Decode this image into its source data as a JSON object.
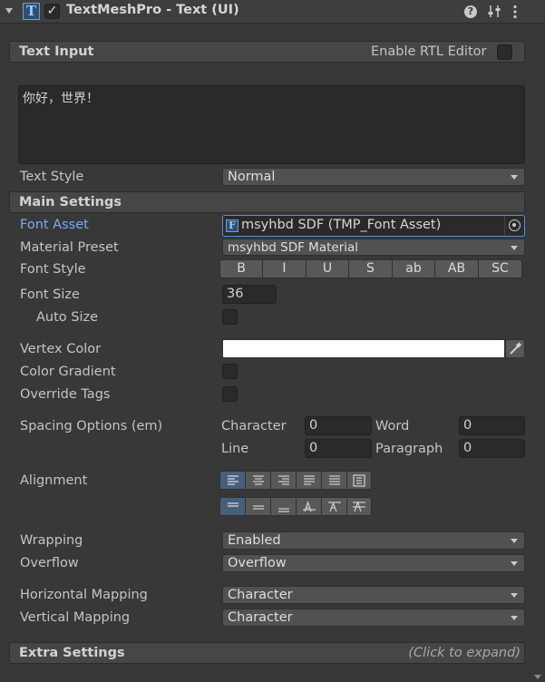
{
  "header": {
    "title": "TextMeshPro - Text (UI)",
    "enabled": true,
    "icons": [
      "tmp-text-icon",
      "help-icon",
      "presets-icon",
      "context-menu-icon"
    ]
  },
  "text_input": {
    "section_title": "Text Input",
    "rtl_label": "Enable RTL Editor",
    "rtl_checked": false,
    "text_value": "你好，世界！",
    "text_style_label": "Text Style",
    "text_style_value": "Normal"
  },
  "main_settings": {
    "section_title": "Main Settings",
    "font_asset_label": "Font Asset",
    "font_asset_value": "msyhbd SDF (TMP_Font Asset)",
    "material_preset_label": "Material Preset",
    "material_preset_value": "msyhbd SDF Material",
    "font_style_label": "Font Style",
    "font_style_buttons": [
      "B",
      "I",
      "U",
      "S",
      "ab",
      "AB",
      "SC"
    ],
    "font_size_label": "Font Size",
    "font_size_value": "36",
    "auto_size_label": "Auto Size",
    "auto_size_checked": false,
    "vertex_color_label": "Vertex Color",
    "vertex_color": "#ffffff",
    "color_gradient_label": "Color Gradient",
    "color_gradient_checked": false,
    "override_tags_label": "Override Tags",
    "override_tags_checked": false,
    "spacing_label": "Spacing Options (em)",
    "spacing_character_label": "Character",
    "spacing_character_value": "0",
    "spacing_word_label": "Word",
    "spacing_word_value": "0",
    "spacing_line_label": "Line",
    "spacing_line_value": "0",
    "spacing_paragraph_label": "Paragraph",
    "spacing_paragraph_value": "0",
    "alignment_label": "Alignment",
    "horizontal_alignment_active": "left",
    "vertical_alignment_active": "top",
    "wrapping_label": "Wrapping",
    "wrapping_value": "Enabled",
    "overflow_label": "Overflow",
    "overflow_value": "Overflow",
    "horizontal_mapping_label": "Horizontal Mapping",
    "horizontal_mapping_value": "Character",
    "vertical_mapping_label": "Vertical Mapping",
    "vertical_mapping_value": "Character"
  },
  "extra_settings": {
    "section_title": "Extra Settings",
    "expand_hint": "(Click to expand)"
  },
  "colors": {
    "accent_blue": "#7baaf7",
    "active_button": "#46607c",
    "panel_bg": "#383838"
  }
}
